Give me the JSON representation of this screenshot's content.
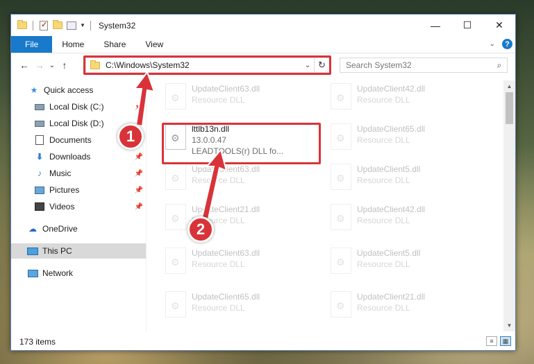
{
  "window": {
    "title": "System32",
    "controls": {
      "minimize": "—",
      "maximize": "☐",
      "close": "✕"
    }
  },
  "ribbon": {
    "tabs": [
      "File",
      "Home",
      "Share",
      "View"
    ],
    "help_icon": "?"
  },
  "nav": {
    "back": "←",
    "forward": "→",
    "recent": "⌄",
    "up": "↑",
    "address": "C:\\Windows\\System32",
    "refresh": "↻",
    "search_placeholder": "Search System32",
    "search_icon": "⌕"
  },
  "sidebar": {
    "items": [
      {
        "label": "Quick access",
        "icon": "star-icon"
      },
      {
        "label": "Local Disk (C:)",
        "icon": "disk-icon",
        "pinned": true
      },
      {
        "label": "Local Disk (D:)",
        "icon": "disk-icon",
        "pinned": true
      },
      {
        "label": "Documents",
        "icon": "document-icon",
        "pinned": true
      },
      {
        "label": "Downloads",
        "icon": "download-icon",
        "pinned": true
      },
      {
        "label": "Music",
        "icon": "music-icon",
        "pinned": true
      },
      {
        "label": "Pictures",
        "icon": "pictures-icon",
        "pinned": true
      },
      {
        "label": "Videos",
        "icon": "videos-icon",
        "pinned": true
      },
      {
        "label": "OneDrive",
        "icon": "cloud-icon"
      },
      {
        "label": "This PC",
        "icon": "computer-icon",
        "selected": true
      },
      {
        "label": "Network",
        "icon": "network-icon"
      }
    ]
  },
  "files": {
    "left": [
      {
        "name": "UpdateClient63.dll",
        "sub": "Resource DLL",
        "faded": true
      },
      {
        "name": "lttlb13n.dll",
        "sub": "13.0.0.47",
        "sub2": "LEADTOOLS(r) DLL fo...",
        "faded": false
      },
      {
        "name": "UpdateClient63.dll",
        "sub": "Resource DLL",
        "faded": true
      },
      {
        "name": "UpdateClient21.dll",
        "sub": "Resource DLL",
        "faded": true
      },
      {
        "name": "UpdateClient63.dll",
        "sub": "Resource DLL",
        "faded": true
      },
      {
        "name": "UpdateClient65.dll",
        "sub": "Resource DLL",
        "faded": true
      }
    ],
    "right": [
      {
        "name": "UpdateClient42.dll",
        "sub": "Resource DLL"
      },
      {
        "name": "UpdateClient65.dll",
        "sub": "Resource DLL"
      },
      {
        "name": "UpdateClient5.dll",
        "sub": "Resource DLL"
      },
      {
        "name": "UpdateClient42.dll",
        "sub": "Resource DLL"
      },
      {
        "name": "UpdateClient5.dll",
        "sub": "Resource DLL"
      },
      {
        "name": "UpdateClient21.dll",
        "sub": "Resource DLL"
      }
    ]
  },
  "status": {
    "items": "173 items"
  },
  "annotations": {
    "step1": "1",
    "step2": "2",
    "color": "#d9333a"
  }
}
